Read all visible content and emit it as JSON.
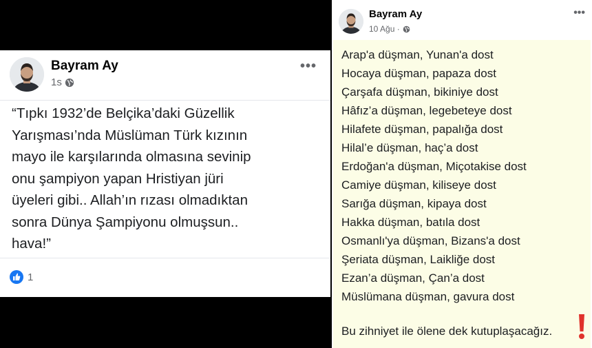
{
  "left_post": {
    "author": "Bayram Ay",
    "time": "1s",
    "more": "•••",
    "lines": [
      "“Tıpkı 1932’de Belçika’daki Güzellik",
      "Yarışması’nda Müslüman Türk kızının",
      "mayo ile karşılarında olmasına sevinip",
      "onu şampiyon yapan Hristiyan jüri",
      "üyeleri gibi.. Allah’ın rızası olmadıktan",
      "sonra Dünya Şampiyonu olmuşsun..",
      "hava!”"
    ],
    "reaction_count": "1",
    "icons": {
      "globe": "globe-icon",
      "like": "like-icon"
    },
    "colors": {
      "like": "#1877f2"
    }
  },
  "right_post": {
    "author": "Bayram Ay",
    "time": "10 Ağu ·",
    "more": "•••",
    "lines": [
      "Arap'a düşman, Yunan'a dost",
      "Hocaya düşman, papaza dost",
      "Çarşafa düşman, bikiniye dost",
      "Hâfız’a düşman, legebeteye dost",
      "Hilafete düşman, papalığa dost",
      "Hilal’e düşman, haç’a dost",
      "Erdoğan'a düşman, Miçotakise dost",
      "Camiye düşman, kiliseye dost",
      "Sarığa düşman, kipaya dost",
      "Hakka düşman, batıla dost",
      "Osmanlı'ya düşman, Bizans'a dost",
      "Şeriata düşman, Laikliğe dost",
      "Ezan’a düşman, Çan’a dost",
      "Müslümana düşman, gavura dost"
    ],
    "closing": "Bu zihniyet ile ölene dek kutuplaşacağız.",
    "colors": {
      "background": "#fcfde6",
      "exclamation": "#e0322b"
    }
  }
}
